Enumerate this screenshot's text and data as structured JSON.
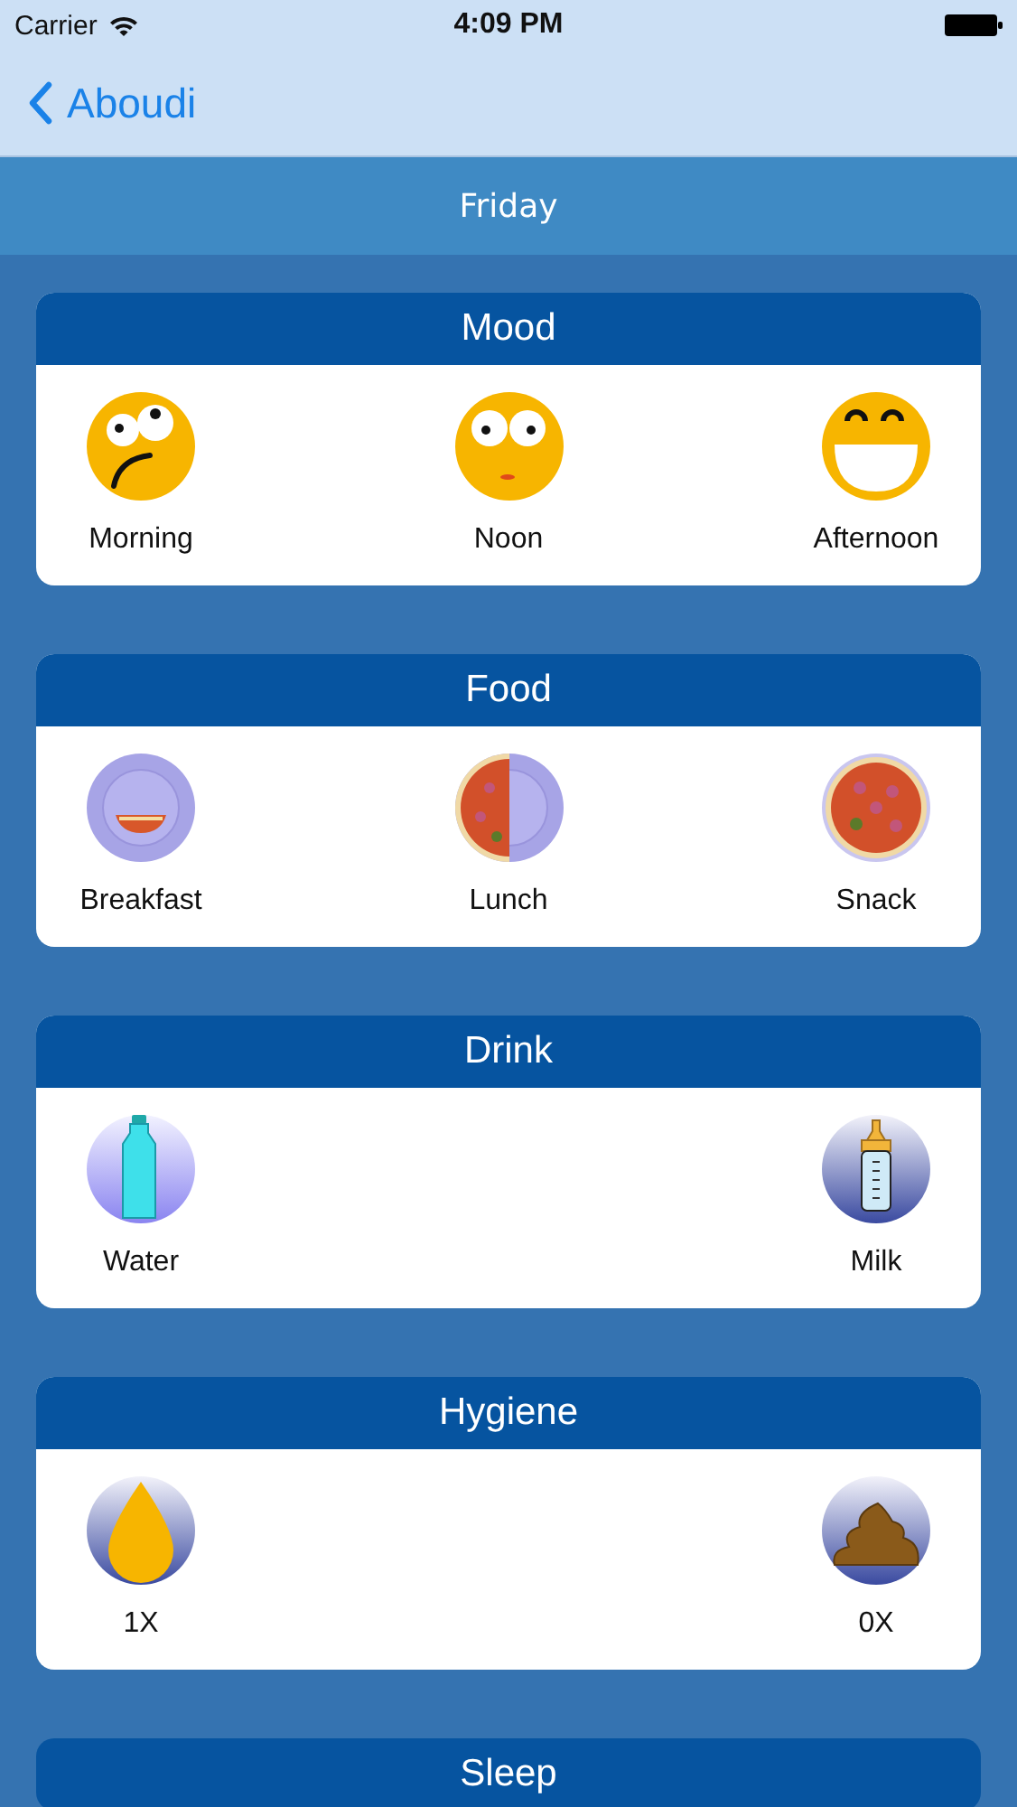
{
  "status_bar": {
    "carrier": "Carrier",
    "time": "4:09 PM"
  },
  "nav_bar": {
    "back_label": "Aboudi"
  },
  "day_bar": {
    "title": "Friday"
  },
  "sections": [
    {
      "title": "Mood",
      "items": [
        {
          "label": "Morning",
          "kind": "face-worried"
        },
        {
          "label": "Noon",
          "kind": "face-surprised"
        },
        {
          "label": "Afternoon",
          "kind": "face-laughing"
        }
      ]
    },
    {
      "title": "Food",
      "items": [
        {
          "label": "Breakfast",
          "kind": "plate-slice"
        },
        {
          "label": "Lunch",
          "kind": "plate-half"
        },
        {
          "label": "Snack",
          "kind": "plate-full"
        }
      ]
    },
    {
      "title": "Drink",
      "items": [
        {
          "label": "Water",
          "kind": "water-bottle"
        },
        {
          "label": "Milk",
          "kind": "baby-bottle"
        }
      ]
    },
    {
      "title": "Hygiene",
      "items": [
        {
          "label": "1X",
          "kind": "drop"
        },
        {
          "label": "0X",
          "kind": "poop"
        }
      ]
    },
    {
      "title": "Sleep"
    }
  ]
}
